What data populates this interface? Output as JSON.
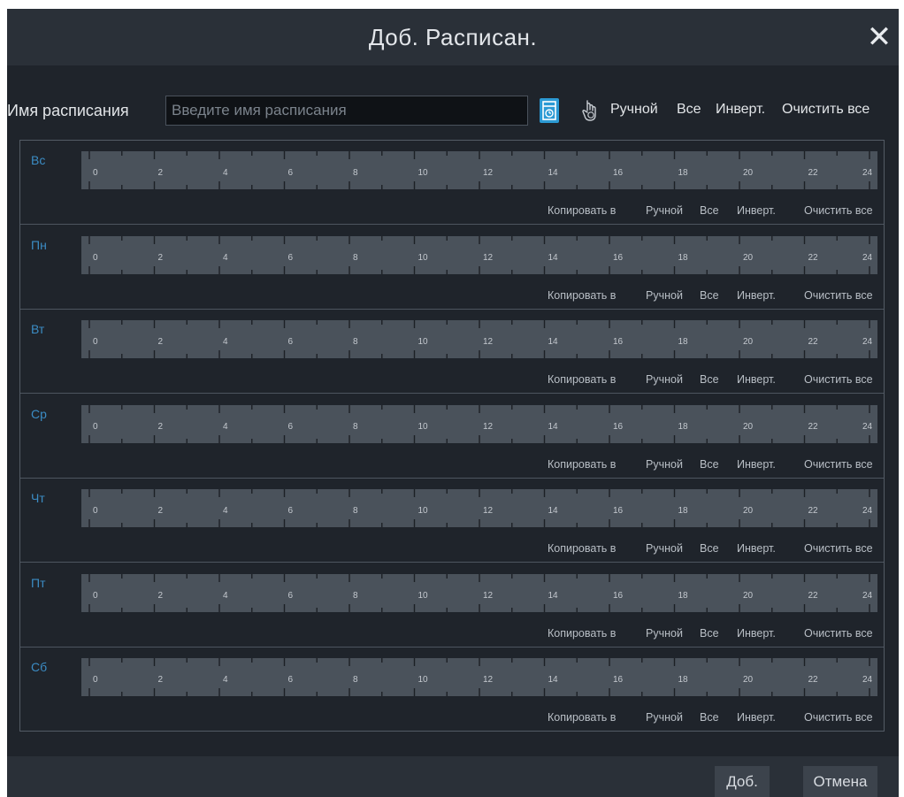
{
  "dialog": {
    "title": "Доб. Расписан.",
    "close_glyph": "✕",
    "close_icon": "close-icon"
  },
  "toolbar": {
    "name_label": "Имя расписания",
    "name_placeholder": "Введите имя расписания",
    "name_value": "",
    "schedule_icon": "schedule-calendar-icon",
    "manual_icon": "hand-pointer-icon",
    "manual": "Ручной",
    "all": "Все",
    "invert": "Инверт.",
    "clear_all": "Очистить все"
  },
  "timeline": {
    "hour_labels": [
      "0",
      "2",
      "4",
      "6",
      "8",
      "10",
      "12",
      "14",
      "16",
      "18",
      "20",
      "22",
      "24"
    ]
  },
  "days": [
    {
      "label": "Вс"
    },
    {
      "label": "Пн"
    },
    {
      "label": "Вт"
    },
    {
      "label": "Ср"
    },
    {
      "label": "Чт"
    },
    {
      "label": "Пт"
    },
    {
      "label": "Сб"
    }
  ],
  "day_actions": {
    "copy_to": "Копировать в",
    "manual": "Ручной",
    "all": "Все",
    "invert": "Инверт.",
    "clear_all": "Очистить все"
  },
  "footer": {
    "add": "Доб.",
    "cancel": "Отмена"
  },
  "colors": {
    "accent": "#2c9ad4",
    "day_label": "#3b8cc4",
    "bar": "#4a525b",
    "background": "#1f242b"
  }
}
